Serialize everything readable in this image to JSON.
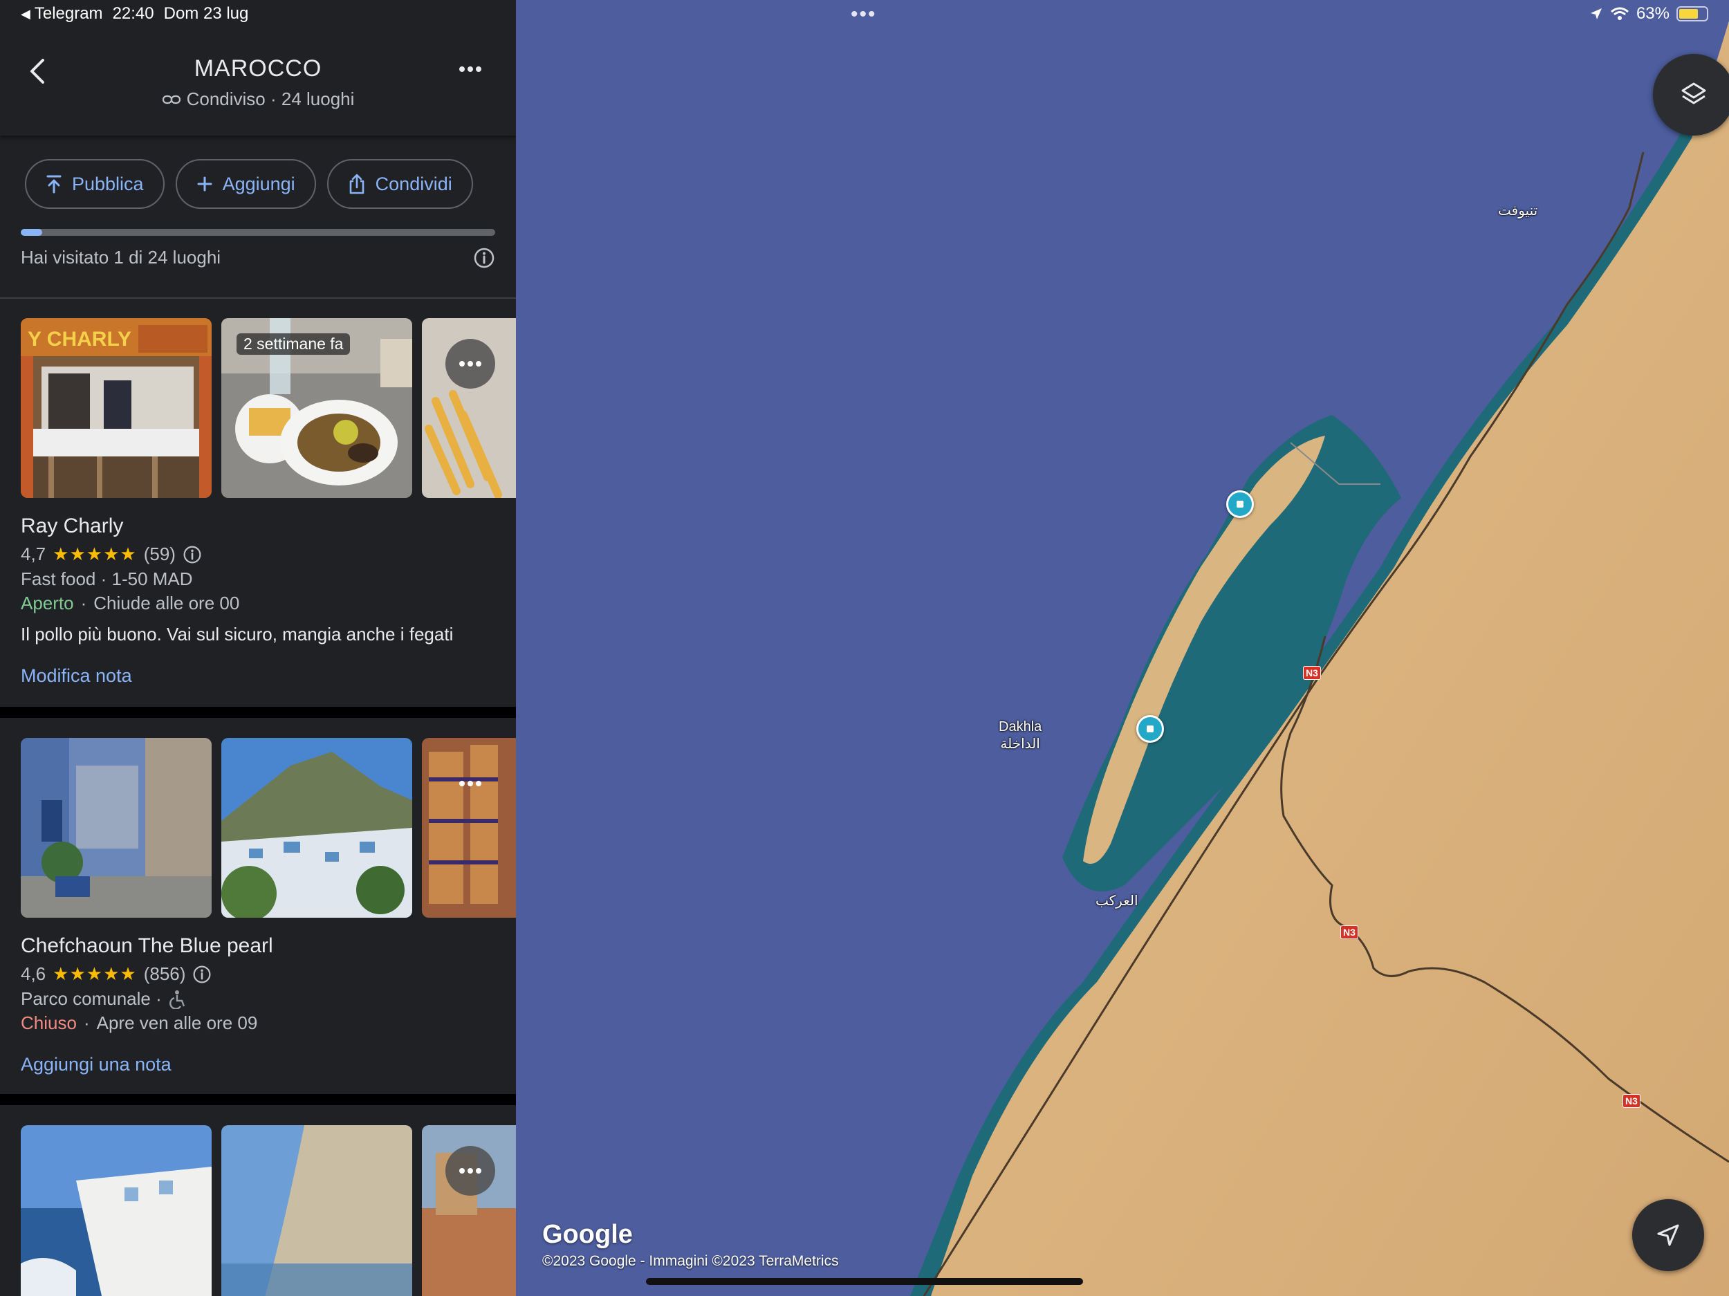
{
  "status_bar": {
    "back_app": "Telegram",
    "time": "22:40",
    "date": "Dom 23 lug",
    "battery": "63%"
  },
  "list_header": {
    "title": "MAROCCO",
    "subtitle": "Condiviso · 24 luoghi"
  },
  "actions": {
    "publish": "Pubblica",
    "add": "Aggiungi",
    "share": "Condividi"
  },
  "progress": {
    "visited": 1,
    "total": 24,
    "text": "Hai visitato 1 di 24 luoghi"
  },
  "places": [
    {
      "photo_badge": "2 settimane fa",
      "name": "Ray Charly",
      "rating": "4,7",
      "stars": "★★★★★",
      "reviews": "(59)",
      "category": "Fast food · 1-50 MAD",
      "status": "Aperto",
      "status_detail": "Chiude alle ore 00",
      "note": "Il pollo più buono. Vai sul sicuro, mangia anche i fegati",
      "link": "Modifica nota"
    },
    {
      "name": "Chefchaoun The Blue pearl",
      "rating": "4,6",
      "stars": "★★★★★",
      "reviews": "(856)",
      "category": "Parco comunale ·",
      "status": "Chiuso",
      "status_detail": "Apre ven alle ore 09",
      "link": "Aggiungi una nota"
    }
  ],
  "map": {
    "labels": {
      "dakhla": "Dakhla",
      "dakhla_ar": "الداخلة",
      "lamhiriz": "العركب",
      "tniguit": "تنيوفت"
    },
    "road_shields": [
      "N3",
      "N3",
      "N3"
    ],
    "google_logo": "Google",
    "copyright": "©2023 Google - Immagini ©2023 TerraMetrics"
  },
  "colors": {
    "accent": "#8ab4f8",
    "open": "#81c995",
    "closed": "#f28b82",
    "star": "#fbbc04",
    "ocean": "#4c5c9c",
    "sand": "#d9b07a"
  }
}
